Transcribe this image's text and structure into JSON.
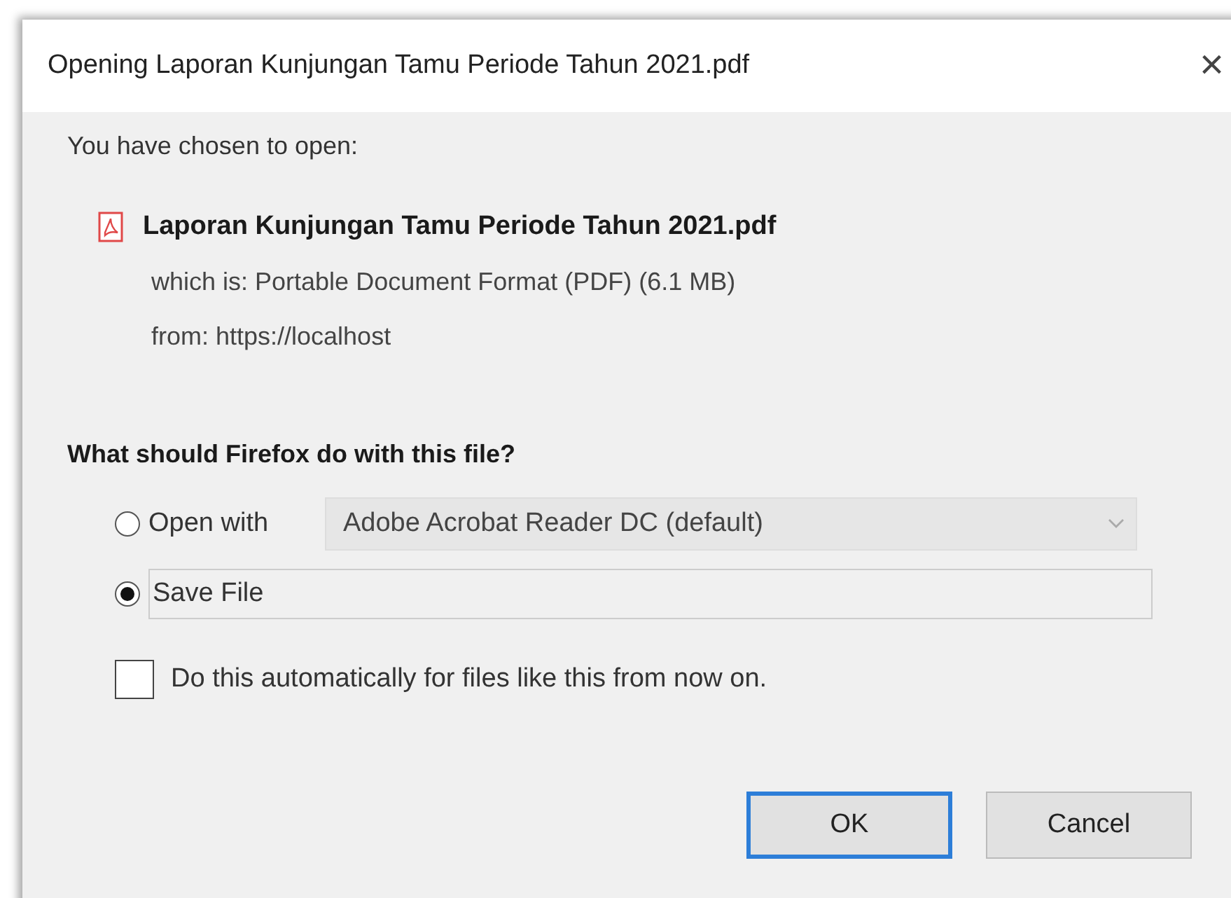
{
  "window": {
    "title": "Opening Laporan Kunjungan Tamu Periode Tahun 2021.pdf",
    "close": "×"
  },
  "intro": "You have chosen to open:",
  "file": {
    "name": "Laporan Kunjungan Tamu Periode Tahun 2021.pdf",
    "type_line": "which is: Portable Document Format (PDF) (6.1 MB)",
    "from_line": "from: https://localhost"
  },
  "question": "What should Firefox do with this file?",
  "options": [
    {
      "kind": "dropdown",
      "label": "Open with",
      "selected": false,
      "value": "Adobe Acrobat Reader DC (default)"
    },
    {
      "kind": "plain",
      "label": "Save File",
      "selected": true
    }
  ],
  "auto": {
    "label": "Do this automatically for files like this from now on.",
    "checked": false
  },
  "buttons": [
    {
      "label": "OK",
      "focused": true
    },
    {
      "label": "Cancel",
      "focused": false
    }
  ]
}
